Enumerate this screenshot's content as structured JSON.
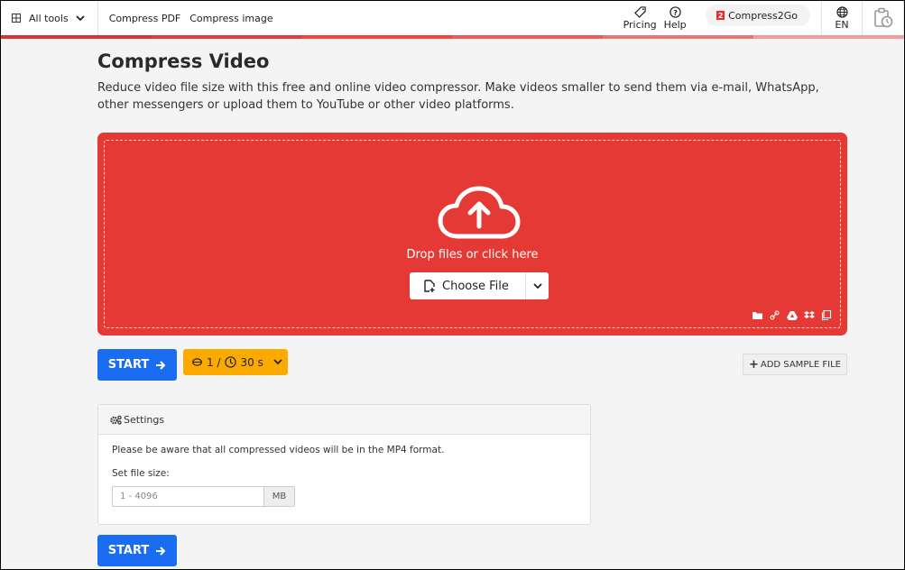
{
  "topbar": {
    "all_tools": "All tools",
    "links": [
      "Compress PDF",
      "Compress image"
    ],
    "pricing": "Pricing",
    "help": "Help",
    "brand_logo": "2",
    "brand": "Compress2Go",
    "language": "EN",
    "colorbar": [
      "#d93435",
      "#e63c3d",
      "#fa4438",
      "#f05a5b",
      "#eb7275",
      "#f59b9d"
    ]
  },
  "page": {
    "title": "Compress Video",
    "description": "Reduce video file size with this free and online video compressor. Make videos smaller to send them via e-mail, WhatsApp, other messengers or upload them to YouTube or other video platforms."
  },
  "upload": {
    "drop_text": "Drop files or click here",
    "choose_file": "Choose File",
    "sources": [
      "folder-icon",
      "link-icon",
      "google-drive-icon",
      "dropbox-icon",
      "clipboard-icon"
    ],
    "accent_color": "#e53935"
  },
  "actions": {
    "start": "START",
    "credits_count": "1 /",
    "time": "30 s",
    "add_sample": "ADD SAMPLE FILE"
  },
  "settings": {
    "header": "Settings",
    "notice": "Please be aware that all compressed videos will be in the MP4 format.",
    "file_size_label": "Set file size:",
    "file_size_placeholder": "1 - 4096",
    "file_size_value": "",
    "unit": "MB"
  }
}
